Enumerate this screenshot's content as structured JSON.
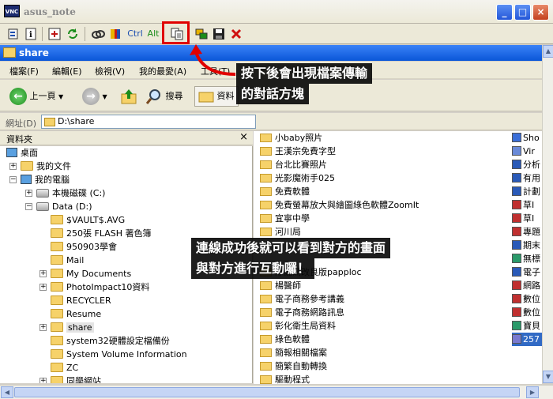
{
  "vnc": {
    "logo": "VNC",
    "title": "asus_note",
    "toolbar_text": {
      "ctrl": "Ctrl",
      "alt": "Alt"
    },
    "icons": [
      "options-icon",
      "info-icon",
      "fullscreen-icon",
      "refresh-icon",
      "ctrl-alt-del-icon",
      "ctrl-esc-icon",
      "ctrl-key",
      "alt-key",
      "file-transfer-icon",
      "chat-icon",
      "save-icon",
      "close-icon"
    ]
  },
  "explorer": {
    "title": "share",
    "menu": [
      "檔案(F)",
      "編輯(E)",
      "檢視(V)",
      "我的最愛(A)",
      "工具(T)"
    ],
    "toolbar": {
      "back": "上一頁",
      "search": "搜尋",
      "folders": "資料"
    },
    "address_label": "網址(D)",
    "address_value": "D:\\share",
    "folders_pane_title": "資料夾",
    "folders_pane_close": "×",
    "tree": [
      {
        "label": "桌面",
        "level": 0,
        "icon": "desktop",
        "expander": ""
      },
      {
        "label": "我的文件",
        "level": 1,
        "icon": "folder",
        "expander": "+"
      },
      {
        "label": "我的電腦",
        "level": 1,
        "icon": "computer",
        "expander": "−"
      },
      {
        "label": "本機磁碟 (C:)",
        "level": 2,
        "icon": "drive",
        "expander": "+"
      },
      {
        "label": "Data (D:)",
        "level": 2,
        "icon": "drive",
        "expander": "−"
      },
      {
        "label": "$VAULT$.AVG",
        "level": 3,
        "icon": "folder",
        "expander": ""
      },
      {
        "label": "250張 FLASH 著色簿",
        "level": 3,
        "icon": "folder",
        "expander": ""
      },
      {
        "label": "950903學會",
        "level": 3,
        "icon": "folder",
        "expander": ""
      },
      {
        "label": "Mail",
        "level": 3,
        "icon": "folder",
        "expander": ""
      },
      {
        "label": "My Documents",
        "level": 3,
        "icon": "folder",
        "expander": "+"
      },
      {
        "label": "PhotoImpact10資料",
        "level": 3,
        "icon": "folder",
        "expander": "+"
      },
      {
        "label": "RECYCLER",
        "level": 3,
        "icon": "folder",
        "expander": ""
      },
      {
        "label": "Resume",
        "level": 3,
        "icon": "folder",
        "expander": ""
      },
      {
        "label": "share",
        "level": 3,
        "icon": "folder",
        "expander": "+",
        "selected": true
      },
      {
        "label": "system32硬體設定檔備份",
        "level": 3,
        "icon": "folder",
        "expander": ""
      },
      {
        "label": "System Volume Information",
        "level": 3,
        "icon": "folder",
        "expander": ""
      },
      {
        "label": "ZC",
        "level": 3,
        "icon": "folder",
        "expander": ""
      },
      {
        "label": "同學網站",
        "level": 3,
        "icon": "folder",
        "expander": "+"
      }
    ],
    "files": [
      "小baby照片",
      "王漢宗免費字型",
      "台北比賽照片",
      "光影魔術手025",
      "免費軟體",
      "免費螢幕放大與繪圖綠色軟體ZoomIt",
      "宜寧中學",
      "河川局",
      "",
      "",
      "除亂碼改良版papploc",
      "楊醫師",
      "電子商務參考講義",
      "電子商務網路訊息",
      "彰化衛生局資料",
      "綠色軟體",
      "簡報相關檔案",
      "簡繁自動轉換",
      "驅動程式"
    ],
    "files_col2": [
      {
        "label": "Sho",
        "icon": "shortcut"
      },
      {
        "label": "Vir",
        "icon": "globe"
      },
      {
        "label": "分析",
        "icon": "doc"
      },
      {
        "label": "有用",
        "icon": "doc"
      },
      {
        "label": "計劃",
        "icon": "doc"
      },
      {
        "label": "草I",
        "icon": "pdf"
      },
      {
        "label": "草I",
        "icon": "pdf"
      },
      {
        "label": "專題",
        "icon": "pdf"
      },
      {
        "label": "期末",
        "icon": "doc"
      },
      {
        "label": "無標",
        "icon": "img"
      },
      {
        "label": "電子",
        "icon": "doc"
      },
      {
        "label": "網路",
        "icon": "pdf"
      },
      {
        "label": "數位",
        "icon": "pdf"
      },
      {
        "label": "數位",
        "icon": "pdf"
      },
      {
        "label": "寶貝",
        "icon": "img"
      },
      {
        "label": "257",
        "icon": "file",
        "selected": true
      }
    ]
  },
  "annotations": {
    "top_line1": "按下後會出現檔案傳輸",
    "top_line2": "的對話方塊",
    "mid_line1": "連線成功後就可以看到對方的畫面",
    "mid_line2": "與對方進行互動囉！"
  },
  "colors": {
    "highlight_box": "#e00000",
    "arrow": "#e00000",
    "title_blue": "#0a56d8",
    "selection": "#316ac5"
  }
}
